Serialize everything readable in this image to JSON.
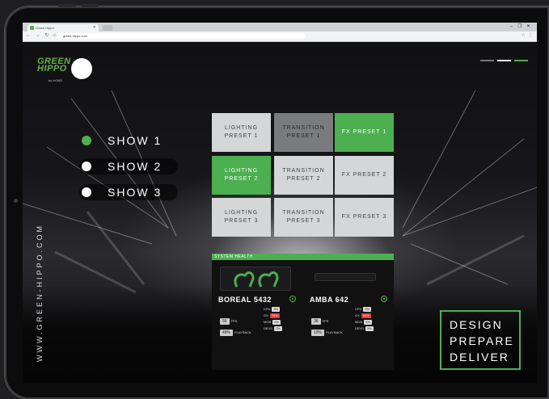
{
  "browser": {
    "tab_title": "Green Hippo",
    "url": "green-hippo.com",
    "window_controls": "– ❐ ✕",
    "nav_icons": "← → ↻ ⌂",
    "icons": [
      "back-icon",
      "forward-icon",
      "reload-icon",
      "home-icon",
      "star-icon",
      "menu-icon"
    ]
  },
  "logo": {
    "name": "GREEN HIPPO",
    "sub": "by tvONE"
  },
  "shows": [
    {
      "label": "SHOW 1",
      "state": "selected",
      "dot_color": "#4caf50"
    },
    {
      "label": "SHOW 2",
      "state": "idle",
      "dot_color": "#ffffff"
    },
    {
      "label": "SHOW 3",
      "state": "idle",
      "dot_color": "#ffffff"
    }
  ],
  "presets": [
    {
      "line1": "LIGHTING",
      "line2": "PRESET 1",
      "state": "grey"
    },
    {
      "line1": "TRANSITION",
      "line2": "PRESET 1",
      "state": "dark"
    },
    {
      "line1": "FX PRESET 1",
      "line2": "",
      "state": "green"
    },
    {
      "line1": "LIGHTING",
      "line2": "PRESET 2",
      "state": "green"
    },
    {
      "line1": "TRANSITION",
      "line2": "PRESET 2",
      "state": "grey"
    },
    {
      "line1": "FX PRESET 2",
      "line2": "",
      "state": "grey"
    },
    {
      "line1": "LIGHTING",
      "line2": "PRESET 3",
      "state": "grey"
    },
    {
      "line1": "TRANSITION",
      "line2": "PRESET 3",
      "state": "grey"
    },
    {
      "line1": "FX PRESET 3",
      "line2": "",
      "state": "grey"
    }
  ],
  "health": {
    "title": "SYSTEM HEALTH",
    "devices": [
      {
        "name": "BOREAL 5432",
        "fps": "56",
        "fps_label": "FPS",
        "playback": "49%",
        "playback_label": "PLAYBACK",
        "stats": [
          {
            "k": "CPU",
            "v": "9%",
            "alert": false
          },
          {
            "k": "GX",
            "v": "78%",
            "alert": true
          },
          {
            "k": "MOB",
            "v": "4%",
            "alert": false
          },
          {
            "k": "DEVS",
            "v": "2%",
            "alert": false
          }
        ]
      },
      {
        "name": "AMBA 642",
        "fps": "36",
        "fps_label": "FPS",
        "playback": "10%",
        "playback_label": "PLAYBACK",
        "stats": [
          {
            "k": "CPU",
            "v": "8%",
            "alert": false
          },
          {
            "k": "GX",
            "v": "81%",
            "alert": true
          },
          {
            "k": "MOB",
            "v": "4%",
            "alert": false
          },
          {
            "k": "DEVS",
            "v": "3%",
            "alert": false
          }
        ]
      }
    ]
  },
  "vertical_url": "WWW.GREEN-HIPPO.COM",
  "tagline": [
    "DESIGN",
    "PREPARE",
    "DELIVER"
  ],
  "colors": {
    "accent": "#4caf50",
    "alert": "#e53935",
    "tile_grey": "#d5d6d8",
    "tile_dark": "#7a7b7d"
  }
}
